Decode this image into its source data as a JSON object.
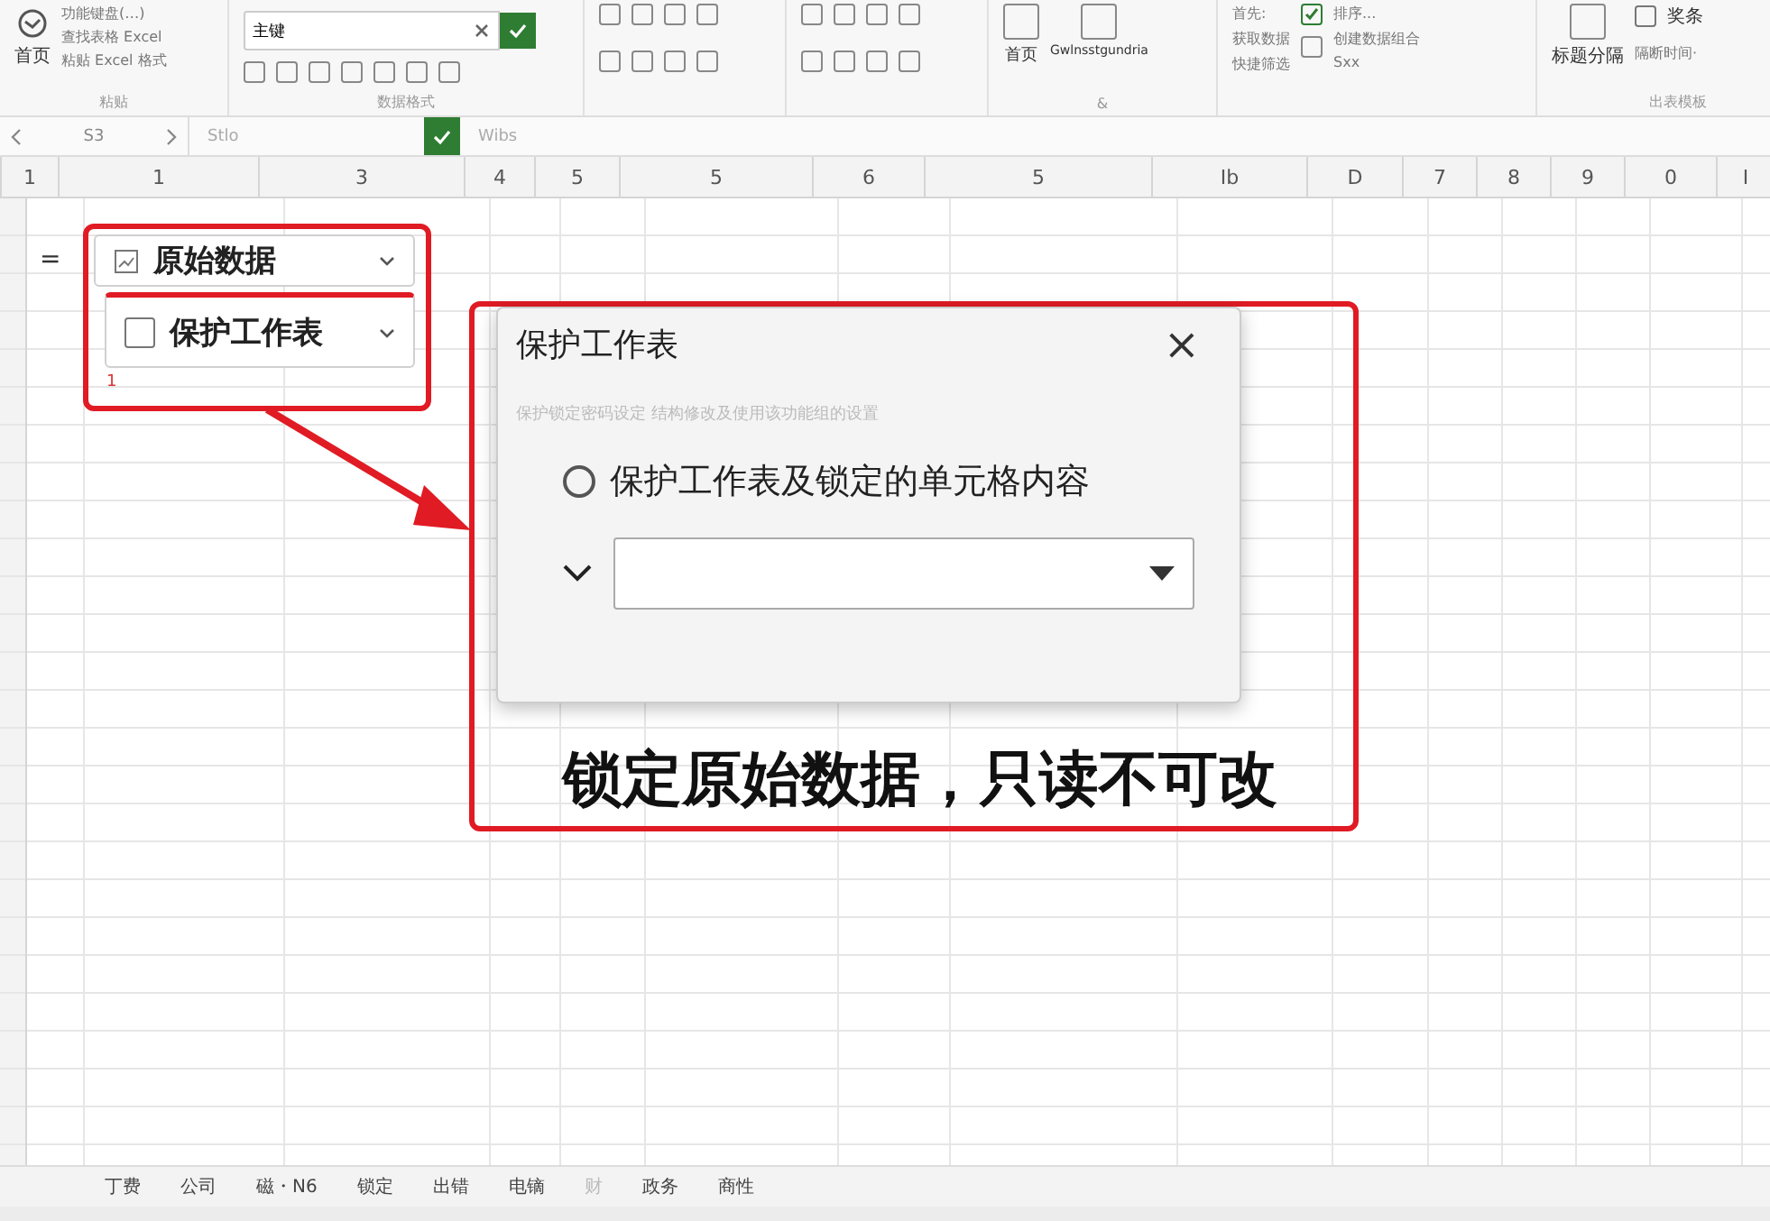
{
  "ribbon": {
    "groups": [
      {
        "kind": "clipboard",
        "big_label": "首页",
        "lines": [
          "功能键盘(…)",
          "查找表格 Excel",
          "粘贴 Excel 格式"
        ],
        "label": "粘贴"
      },
      {
        "kind": "search",
        "value": "主键",
        "label": "数据格式"
      },
      {
        "kind": "icons"
      },
      {
        "kind": "icons"
      },
      {
        "kind": "insert",
        "buttons": [
          "首页",
          "Gwlnsstgundria"
        ],
        "label": "&"
      },
      {
        "kind": "sort",
        "lines": [
          "首先:",
          "获取数据",
          "快捷筛选"
        ],
        "checked": true,
        "sort_label": "排序...",
        "group_label": "创建数据组合",
        "extra": "Sxx"
      },
      {
        "kind": "layout",
        "big_label": "标题分隔",
        "checkbox_label": "奖条",
        "checked": false,
        "link": "隔断时间·",
        "label": "出表模板"
      }
    ]
  },
  "formula_bar": {
    "cell": "S3",
    "formula": "Stlo",
    "value": "Wibs"
  },
  "columns": [
    {
      "label": "1"
    },
    {
      "label": "1"
    },
    {
      "label": "3"
    },
    {
      "label": "4"
    },
    {
      "label": "5"
    },
    {
      "label": "5"
    },
    {
      "label": "6"
    },
    {
      "label": "5"
    },
    {
      "label": "Ib"
    },
    {
      "label": "D"
    },
    {
      "label": "7"
    },
    {
      "label": "8"
    },
    {
      "label": "9"
    },
    {
      "label": "0"
    },
    {
      "label": "I"
    }
  ],
  "cell_text": "=",
  "callout": {
    "dropdowns": [
      {
        "label": "原始数据",
        "kind": "chart"
      },
      {
        "label": "保护工作表",
        "kind": "checkbox",
        "checked": false
      }
    ],
    "marker": "1"
  },
  "dialog": {
    "title": "保护工作表",
    "close": "×",
    "description": "保护锁定密码设定 结构修改及使用该功能组的设置",
    "option": {
      "label": "保护工作表及锁定的单元格内容",
      "selected": false
    }
  },
  "caption": "锁定原始数据，只读不可改",
  "sheet_tabs": [
    {
      "label": "丁费",
      "disabled": false
    },
    {
      "label": "公司",
      "disabled": false
    },
    {
      "label": "磁・N6",
      "disabled": false
    },
    {
      "label": "锁定",
      "disabled": false
    },
    {
      "label": "出错",
      "disabled": false
    },
    {
      "label": "电镝",
      "disabled": false
    },
    {
      "label": "财",
      "disabled": true
    },
    {
      "label": "政务",
      "disabled": false
    },
    {
      "label": "商性",
      "disabled": false
    }
  ]
}
